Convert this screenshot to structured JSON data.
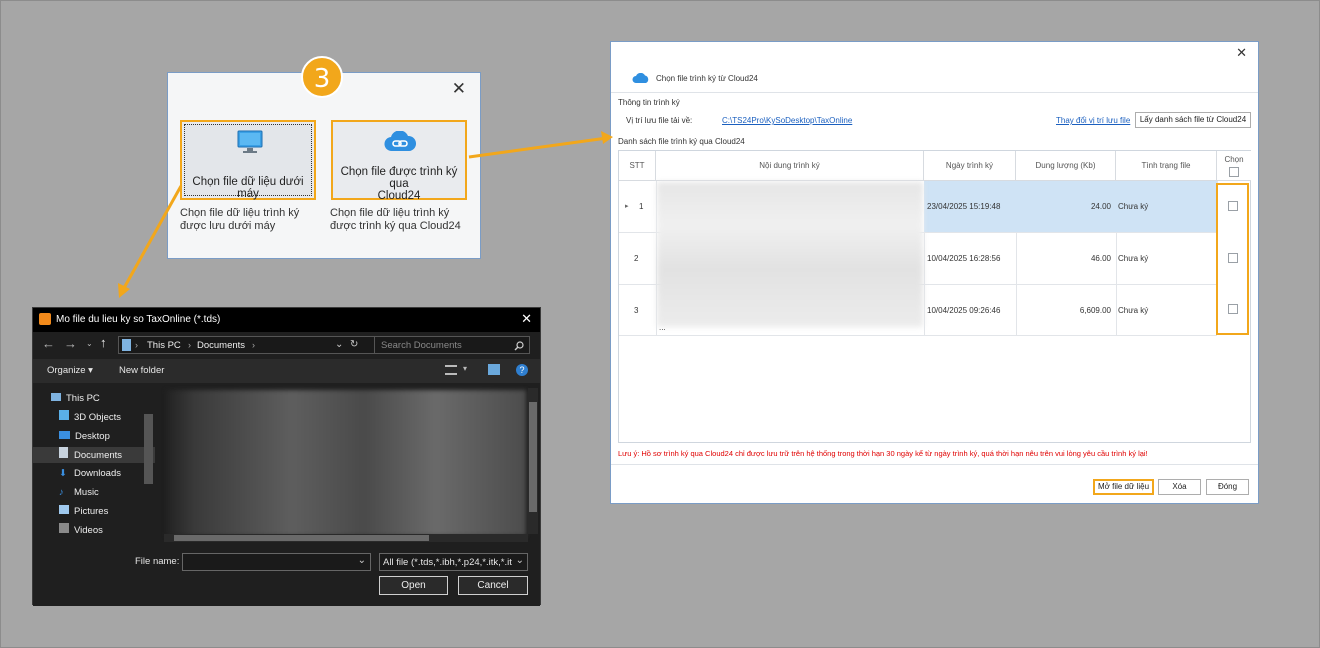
{
  "chooser": {
    "step": "3",
    "option_local_label": "Chọn file dữ liệu dưới máy",
    "option_local_desc_1": "Chọn file dữ liệu trình ký",
    "option_local_desc_2": "được lưu dưới máy",
    "option_cloud_label_1": "Chọn file được trình ký qua",
    "option_cloud_label_2": "Cloud24",
    "option_cloud_desc_1": "Chọn file dữ liệu trình ký",
    "option_cloud_desc_2": "được trình ký qua Cloud24"
  },
  "file_dialog": {
    "title": "Mo file du lieu ky so TaxOnline (*.tds)",
    "path": [
      "This PC",
      "Documents"
    ],
    "search_placeholder": "Search Documents",
    "organize": "Organize ▾",
    "new_folder": "New folder",
    "nav": [
      "This PC",
      "3D Objects",
      "Desktop",
      "Documents",
      "Downloads",
      "Music",
      "Pictures",
      "Videos"
    ],
    "file_name_label": "File name:",
    "file_name_value": "",
    "filter": "All file (*.tds,*.ibh,*.p24,*.itk,*.it",
    "open": "Open",
    "cancel": "Cancel"
  },
  "cloud_dialog": {
    "title": "Chọn file trình ký từ Cloud24",
    "section_info": "Thông tin trình ký",
    "save_path_label": "Vị trí lưu file tải về:",
    "save_path": "C:\\TS24Pro\\KySoDesktop\\TaxOnline",
    "change_location": "Thay đổi vị trí lưu file",
    "fetch_list": "Lấy danh sách file từ Cloud24",
    "list_title": "Danh sách file trình ký qua Cloud24",
    "columns": [
      "STT",
      "Nội dung trình ký",
      "Ngày trình ký",
      "Dung lượng (Kb)",
      "Tình trạng file",
      "Chọn"
    ],
    "rows": [
      {
        "stt": "1",
        "date": "23/04/2025 15:19:48",
        "size": "24.00",
        "status": "Chưa ký"
      },
      {
        "stt": "2",
        "date": "10/04/2025 16:28:56",
        "size": "46.00",
        "status": "Chưa ký"
      },
      {
        "stt": "3",
        "date": "10/04/2025 09:26:46",
        "size": "6,609.00",
        "status": "Chưa ký"
      }
    ],
    "note": "Lưu ý: Hồ sơ trình ký qua Cloud24 chỉ được lưu trữ trên hệ thống trong thời hạn 30 ngày kể từ ngày trình ký, quá thời hạn nêu trên vui lòng yêu cầu trình ký lại!",
    "btn_open": "Mở file dữ liệu",
    "btn_delete": "Xóa",
    "btn_close": "Đóng",
    "ellipsis": "..."
  },
  "colors": {
    "accent": "#f2a71b",
    "selected_row": "#cfe3f5",
    "note_red": "#e00000",
    "cloud_blue": "#2f8fe0"
  }
}
